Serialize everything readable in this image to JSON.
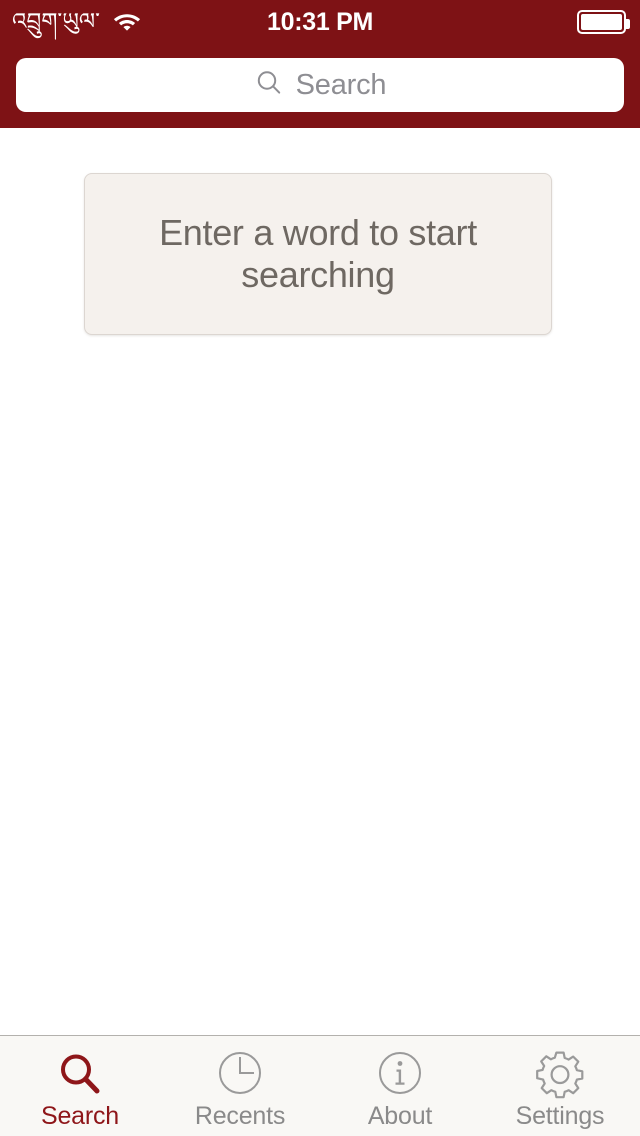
{
  "status_bar": {
    "carrier": "འབྲུག་ཡུལ་",
    "wifi_icon": "wifi-icon",
    "time": "10:31 PM",
    "battery_icon": "battery-full-icon"
  },
  "search": {
    "icon": "search-icon",
    "placeholder": "Search",
    "value": ""
  },
  "main": {
    "empty_state_message": "Enter a word to start searching"
  },
  "tabbar": {
    "items": [
      {
        "label": "Search",
        "icon": "magnifier-icon",
        "active": true
      },
      {
        "label": "Recents",
        "icon": "clock-icon",
        "active": false
      },
      {
        "label": "About",
        "icon": "info-icon",
        "active": false
      },
      {
        "label": "Settings",
        "icon": "gear-icon",
        "active": false
      }
    ]
  },
  "colors": {
    "brand_red": "#7e1215",
    "accent_red": "#8e1619",
    "card_bg": "#f5f1ed",
    "tabbar_bg": "#f9f8f5",
    "muted_text": "#8a8a8a"
  }
}
